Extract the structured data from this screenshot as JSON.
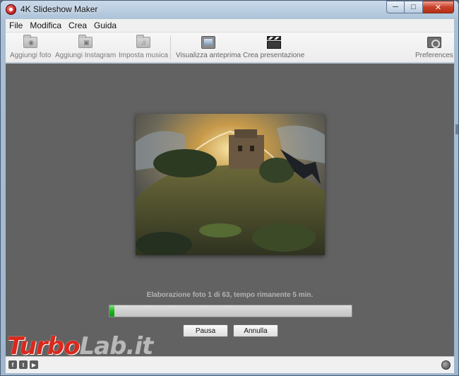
{
  "window": {
    "title": "4K Slideshow Maker",
    "controls": {
      "minimize": "─",
      "maximize": "□",
      "close": "✕"
    }
  },
  "menu": {
    "items": [
      "File",
      "Modifica",
      "Crea",
      "Guida"
    ]
  },
  "toolbar": {
    "add_photo": "Aggiungi foto",
    "add_instagram": "Aggiungi Instagram",
    "set_music": "Imposta musica",
    "preview": "Visualizza anteprima",
    "create": "Crea presentazione",
    "preferences": "Preferences"
  },
  "main": {
    "status": "Elaborazione foto 1 di 63, tempo rimanente 5 min.",
    "progress_fraction": 0.02,
    "pause_label": "Pausa",
    "cancel_label": "Annulla"
  },
  "watermark": {
    "brand_a": "Turbo",
    "brand_b": "Lab.it"
  },
  "colors": {
    "progress": "#1fb51f",
    "canvas": "#626262",
    "watermark_red": "#d9291d"
  },
  "icons": {
    "social": [
      "facebook-icon",
      "twitter-icon",
      "youtube-icon"
    ],
    "globe": "globe-icon"
  }
}
